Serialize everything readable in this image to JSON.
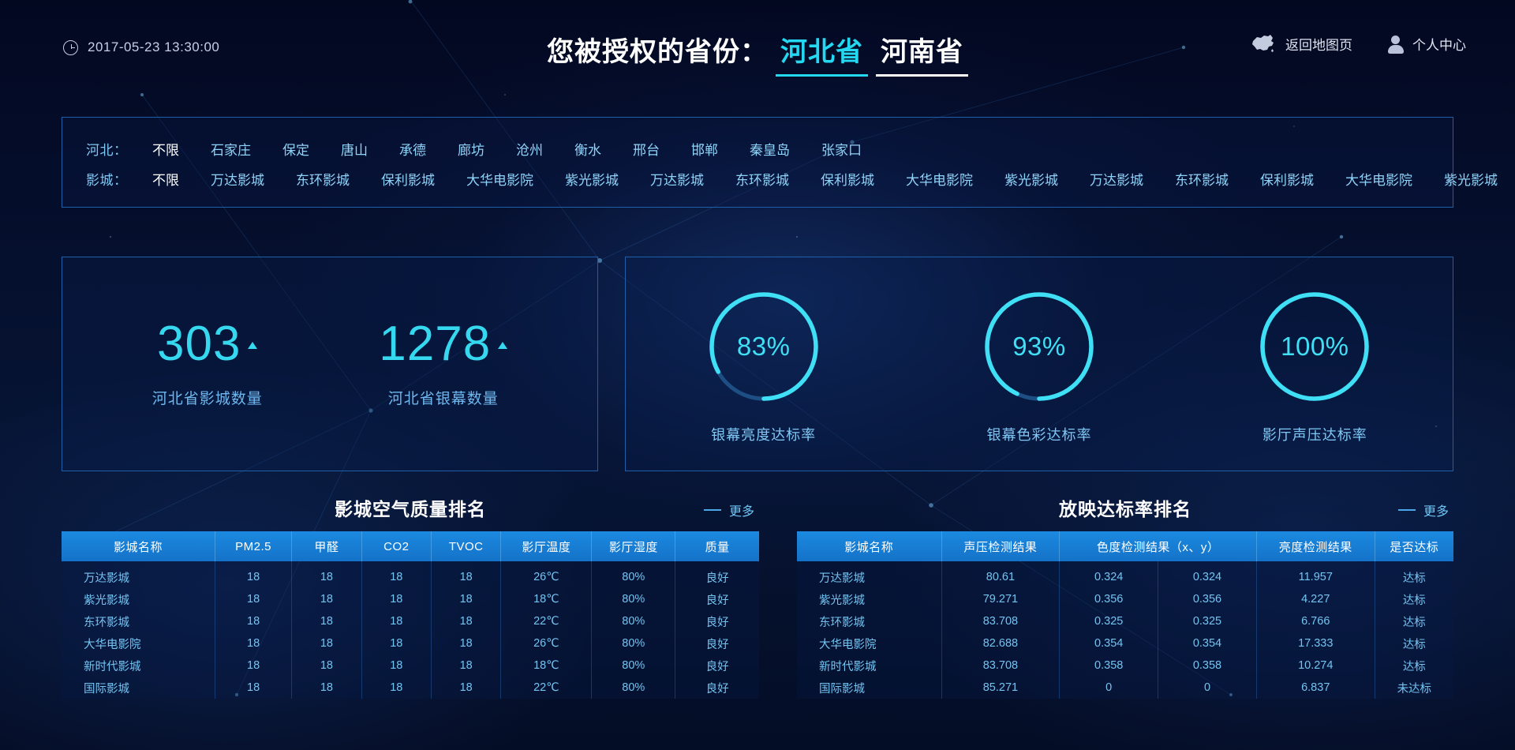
{
  "header": {
    "datetime": "2017-05-23  13:30:00",
    "clock_icon": "clock-icon",
    "title_prefix": "您被授权的省份：",
    "provinces": [
      {
        "name": "河北省",
        "active": true
      },
      {
        "name": "河南省",
        "active": false
      }
    ],
    "map_link": "返回地图页",
    "map_icon": "china-map-icon",
    "user_link": "个人中心",
    "user_icon": "user-avatar-icon"
  },
  "filters": {
    "rows": [
      {
        "label": "河北：",
        "items": [
          "不限",
          "石家庄",
          "保定",
          "唐山",
          "承德",
          "廊坊",
          "沧州",
          "衡水",
          "邢台",
          "邯郸",
          "秦皇岛",
          "张家口"
        ],
        "active_index": 0
      },
      {
        "label": "影城：",
        "items": [
          "不限",
          "万达影城",
          "东环影城",
          "保利影城",
          "大华电影院",
          "紫光影城",
          "万达影城",
          "东环影城",
          "保利影城",
          "大华电影院",
          "紫光影城",
          "万达影城",
          "东环影城",
          "保利影城",
          "大华电影院",
          "紫光影城"
        ],
        "active_index": 0
      }
    ]
  },
  "stats": [
    {
      "value": "303",
      "label": "河北省影城数量",
      "trend": "up"
    },
    {
      "value": "1278",
      "label": "河北省银幕数量",
      "trend": "up"
    }
  ],
  "gauges": [
    {
      "value": "83%",
      "percent": 83,
      "label": "银幕亮度达标率"
    },
    {
      "value": "93%",
      "percent": 93,
      "label": "银幕色彩达标率"
    },
    {
      "value": "100%",
      "percent": 100,
      "label": "影厅声压达标率"
    }
  ],
  "tables": [
    {
      "title": "影城空气质量排名",
      "more": "更多",
      "columns": [
        "影城名称",
        "PM2.5",
        "甲醛",
        "CO2",
        "TVOC",
        "影厅温度",
        "影厅湿度",
        "质量"
      ],
      "rows": [
        [
          "万达影城",
          "18",
          "18",
          "18",
          "18",
          "26℃",
          "80%",
          "良好"
        ],
        [
          "紫光影城",
          "18",
          "18",
          "18",
          "18",
          "18℃",
          "80%",
          "良好"
        ],
        [
          "东环影城",
          "18",
          "18",
          "18",
          "18",
          "22℃",
          "80%",
          "良好"
        ],
        [
          "大华电影院",
          "18",
          "18",
          "18",
          "18",
          "26℃",
          "80%",
          "良好"
        ],
        [
          "新时代影城",
          "18",
          "18",
          "18",
          "18",
          "18℃",
          "80%",
          "良好"
        ],
        [
          "国际影城",
          "18",
          "18",
          "18",
          "18",
          "22℃",
          "80%",
          "良好"
        ]
      ]
    },
    {
      "title": "放映达标率排名",
      "more": "更多",
      "columns": [
        "影城名称",
        "声压检测结果",
        "色度检测结果（x、y）",
        "",
        "亮度检测结果",
        "是否达标"
      ],
      "rows": [
        [
          "万达影城",
          "80.61",
          "0.324",
          "0.324",
          "11.957",
          "达标"
        ],
        [
          "紫光影城",
          "79.271",
          "0.356",
          "0.356",
          "4.227",
          "达标"
        ],
        [
          "东环影城",
          "83.708",
          "0.325",
          "0.325",
          "6.766",
          "达标"
        ],
        [
          "大华电影院",
          "82.688",
          "0.354",
          "0.354",
          "17.333",
          "达标"
        ],
        [
          "新时代影城",
          "83.708",
          "0.358",
          "0.358",
          "10.274",
          "达标"
        ],
        [
          "国际影城",
          "85.271",
          "0",
          "0",
          "6.837",
          "未达标"
        ]
      ]
    }
  ],
  "colors": {
    "accent_cyan": "#35d8ef",
    "link_blue": "#74c4f2",
    "header_blue": "#1b8ae0",
    "border_blue": "#1e5fa8",
    "bg_dark": "#040a25"
  }
}
